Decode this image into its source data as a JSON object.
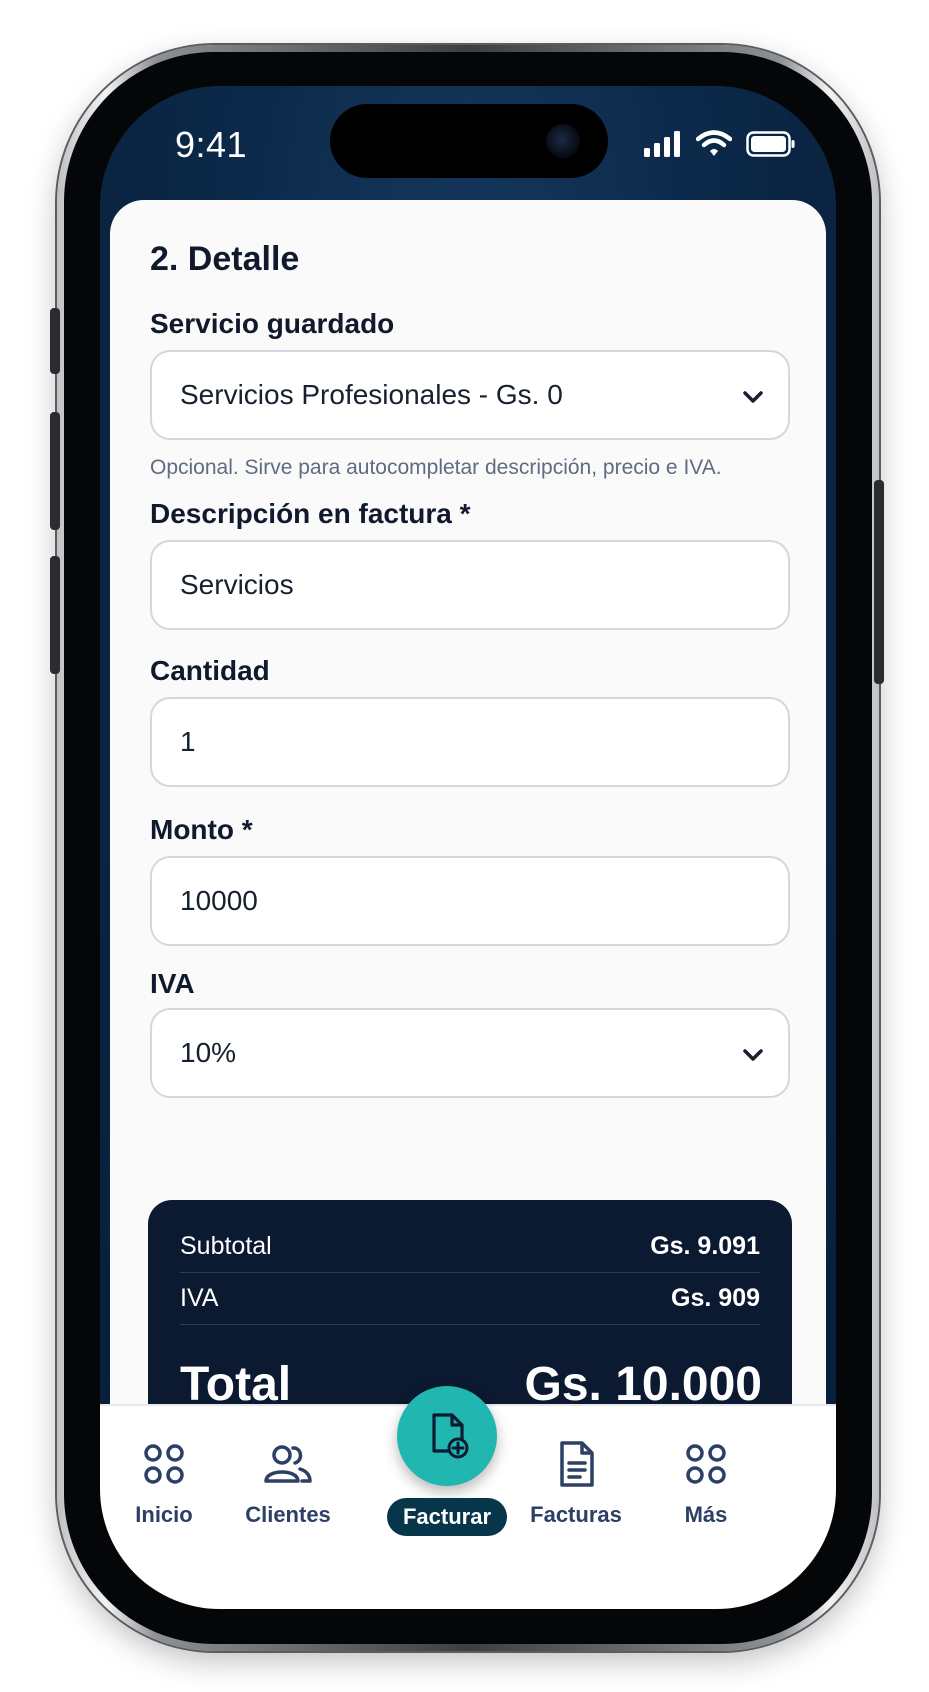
{
  "status_bar": {
    "time": "9:41",
    "icons": [
      "signal-icon",
      "wifi-icon",
      "battery-icon"
    ]
  },
  "section": {
    "title": "2. Detalle"
  },
  "form": {
    "saved_service": {
      "label": "Servicio guardado",
      "value": "Servicios Profesionales - Gs. 0",
      "helper": "Opcional. Sirve para autocompletar descripción, precio e IVA."
    },
    "description": {
      "label": "Descripción en factura *",
      "value": "Servicios"
    },
    "quantity": {
      "label": "Cantidad",
      "value": "1"
    },
    "amount": {
      "label": "Monto *",
      "value": "10000"
    },
    "iva": {
      "label": "IVA",
      "value": "10%"
    }
  },
  "summary": {
    "subtotal_label": "Subtotal",
    "subtotal_value": "Gs. 9.091",
    "iva_label": "IVA",
    "iva_value": "Gs. 909",
    "total_label": "Total",
    "total_value": "Gs. 10.000"
  },
  "nav": {
    "items": [
      {
        "label": "Inicio",
        "icon": "grid-icon"
      },
      {
        "label": "Clientes",
        "icon": "users-icon"
      },
      {
        "label": "Facturar",
        "icon": "new-invoice-icon",
        "active": true
      },
      {
        "label": "Facturas",
        "icon": "document-icon"
      },
      {
        "label": "Más",
        "icon": "grid-icon"
      }
    ]
  },
  "colors": {
    "screen_bg": "#0c2a4b",
    "summary_bg": "#0b1a30",
    "accent": "#21b6b0",
    "active_pill": "#07364a",
    "nav_text": "#2c4066"
  }
}
